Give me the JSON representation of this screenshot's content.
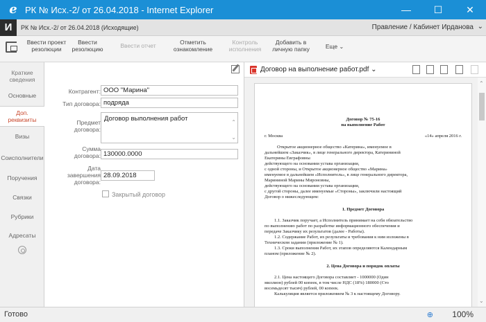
{
  "window": {
    "title": "РК № Исх.-2/ от 26.04.2018 - Internet Explorer",
    "minimize": "—",
    "maximize": "☐",
    "close": "✕"
  },
  "app": {
    "logo": "И",
    "doc_title": "РК № Исх.-2/ от 26.04.2018 (Исходящие)",
    "user": "Правление / Кабинет Ирданова",
    "chevron": "⌄"
  },
  "toolbar": {
    "items": [
      {
        "label1": "Ввести проект",
        "label2": "резолюции"
      },
      {
        "label1": "Ввести",
        "label2": "резолюцию"
      },
      {
        "label1": "Ввести отчет",
        "label2": ""
      },
      {
        "label1": "Отметить",
        "label2": "ознакомление"
      },
      {
        "label1": "Контроль",
        "label2": "исполнения"
      },
      {
        "label1": "Добавить в",
        "label2": "личную папку"
      },
      {
        "label1": "Еще",
        "label2": ""
      }
    ]
  },
  "sidebar": {
    "items": [
      {
        "label1": "Краткие",
        "label2": "сведения"
      },
      {
        "label1": "Основные",
        "label2": ""
      },
      {
        "label1": "Доп.",
        "label2": "реквизиты"
      },
      {
        "label1": "Визы",
        "label2": ""
      },
      {
        "label1": "Соисполнители",
        "label2": ""
      },
      {
        "label1": "Поручения",
        "label2": ""
      },
      {
        "label1": "Связки",
        "label2": ""
      },
      {
        "label1": "Рубрики",
        "label2": ""
      },
      {
        "label1": "Адресаты",
        "label2": ""
      }
    ]
  },
  "form": {
    "contractor_label": "Контрагент:",
    "contractor_value": "ООО \"Марина\"",
    "type_label": "Тип договора:",
    "type_value": "подряда",
    "subject_label1": "Предмет",
    "subject_label2": "договора:",
    "subject_value": "Договор выполнения работ",
    "sum_label1": "Сумма",
    "sum_label2": "договора:",
    "sum_value": "130000.0000",
    "date_label1": "Дата",
    "date_label2": "завершения",
    "date_label3": "договора:",
    "date_value": "28.09.2018",
    "closed_label": "Закрытый договор"
  },
  "viewer": {
    "file_name": "Договор на выполнение работ.pdf ⌄",
    "doc": {
      "title": "Договор № 75-16",
      "subtitle": "на выполнение Работ",
      "city": "г. Москва",
      "date": "«14» апреля 2016 г.",
      "p1": "Открытое акционерное общество «Катерина», именуемое в",
      "p2": "дальнейшем «Заказчик», в лице генерального директора, Катерининой",
      "p3": "Екатерины Евграфовны",
      "p4": "действующего на основании устава организации,",
      "p5": "с одной стороны, и Открытое акционерное общество «Марина»",
      "p6": "именуемое в дальнейшем «Исполнитель», в лице генерального директора,",
      "p7": "Марининой Марины Мироновны,",
      "p8": "действующего на основании устава организации,",
      "p9": "с другой стороны, далее именуемые «Стороны», заключили настоящий",
      "p10": "Договор о нижеследующем:",
      "s1": "1. Предмет Договора",
      "s1p1": "1.1. Заказчик поручает, а Исполнитель принимает на себя обязательство",
      "s1p2": "по выполнению работ по разработке информационного обеспечения и",
      "s1p3": "передаче Заказчику их результатов (далее - Работы).",
      "s1p4": "1.2. Содержание Работ, их результаты и требования к ним изложены в",
      "s1p5": "Техническом задании (приложение № 1).",
      "s1p6": "1.3. Сроки выполнения Работ, их этапов определяются Календарным",
      "s1p7": "планом (приложение № 2).",
      "s2": "2. Цена Договора и порядок оплаты",
      "s2p1": "2.1. Цена настоящего Договора составляет - 1000000 (Один",
      "s2p2": "миллион) рублей 00 копеек, в том числе НДС (18%) 180000 (Сто",
      "s2p3": "восемьдесят тысяч) рублей, 00 копеек.",
      "s2p4": "Калькуляция является приложением № 3 к настоящему Договору."
    }
  },
  "status": {
    "text": "Готово",
    "zoom": "100%"
  }
}
